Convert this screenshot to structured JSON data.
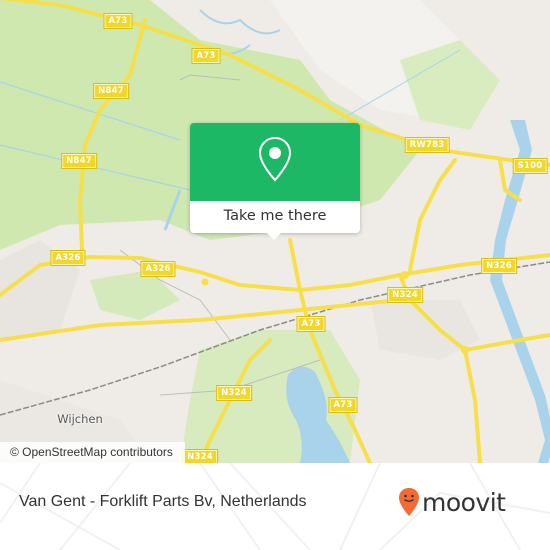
{
  "map": {
    "road_labels": [
      {
        "id": "a73-top",
        "text": "A73"
      },
      {
        "id": "a73-top2",
        "text": "A73"
      },
      {
        "id": "n847-1",
        "text": "N847"
      },
      {
        "id": "n847-2",
        "text": "N847"
      },
      {
        "id": "rw783",
        "text": "RW783"
      },
      {
        "id": "s100",
        "text": "S100"
      },
      {
        "id": "a326-1",
        "text": "A326"
      },
      {
        "id": "a326-2",
        "text": "A326"
      },
      {
        "id": "n326",
        "text": "N326"
      },
      {
        "id": "n324-1",
        "text": "N324"
      },
      {
        "id": "a73-mid",
        "text": "A73"
      },
      {
        "id": "n324-2",
        "text": "N324"
      },
      {
        "id": "a73-low",
        "text": "A73"
      },
      {
        "id": "n324-3",
        "text": "N324"
      }
    ],
    "place_labels": [
      {
        "id": "wijchen",
        "text": "Wijchen"
      }
    ],
    "attribution": "© OpenStreetMap contributors",
    "colors": {
      "land": "#efece8",
      "green": "#cfe8b0",
      "water": "#a9d3ea",
      "road": "#f7df4a",
      "popup_green": "#1db866"
    }
  },
  "popup": {
    "icon": "map-pin-icon",
    "button_label": "Take me there"
  },
  "footer": {
    "place_name": "Van Gent - Forklift Parts Bv, Netherlands",
    "brand": "moovit",
    "brand_color": "#f26b34"
  }
}
